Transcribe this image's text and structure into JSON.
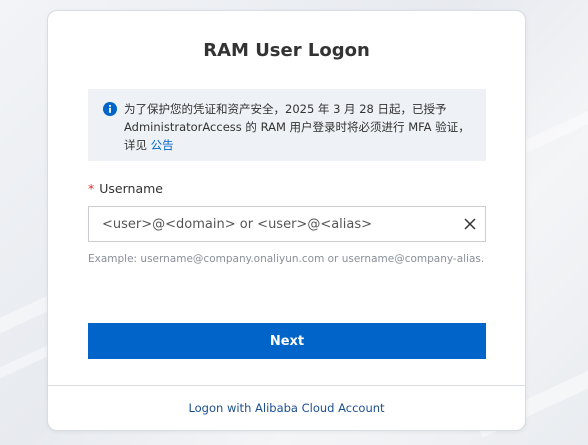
{
  "page": {
    "title": "RAM User Logon"
  },
  "notice": {
    "icon": "info-icon",
    "text": "为了保护您的凭证和资产安全，2025 年 3 月 28 日起，已授予 AdministratorAccess 的 RAM 用户登录时将必须进行 MFA 验证，详见 ",
    "link_label": "公告"
  },
  "username": {
    "required_mark": "*",
    "label": "Username",
    "placeholder": "<user>@<domain> or <user>@<alias>",
    "value": "",
    "hint": "Example: username@company.onaliyun.com or username@company-alias."
  },
  "actions": {
    "next_label": "Next",
    "alibaba_logon_label": "Logon with Alibaba Cloud Account"
  },
  "colors": {
    "primary": "#0064c8",
    "required": "#d93026"
  }
}
